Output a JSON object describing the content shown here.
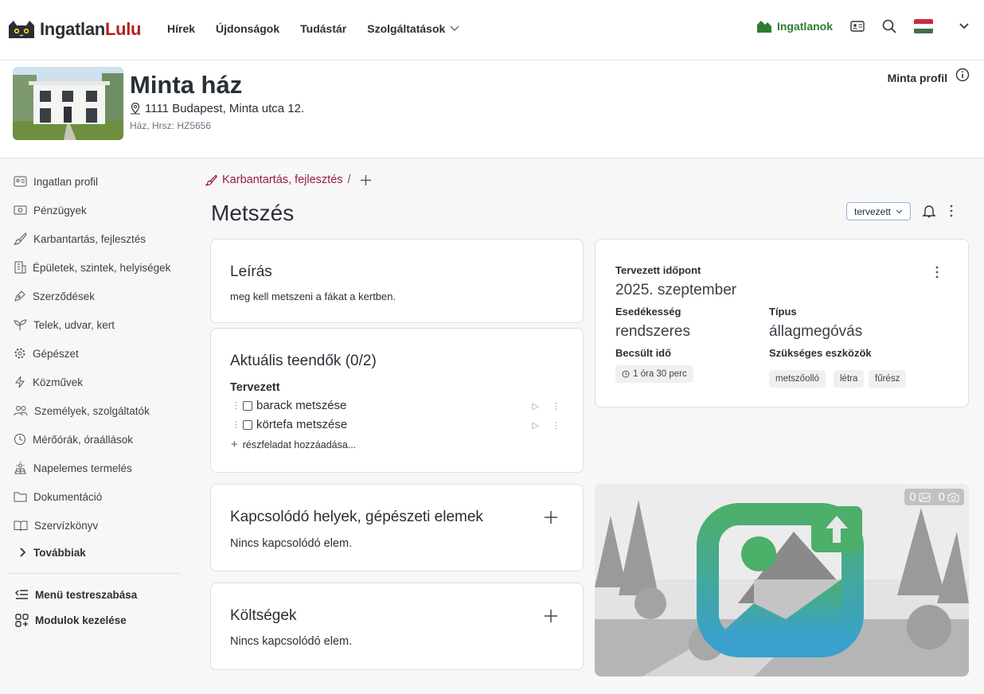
{
  "brand": {
    "part1": "Ingatlan",
    "part2": "Lulu"
  },
  "nav": {
    "items": [
      "Hírek",
      "Újdonságok",
      "Tudástár",
      "Szolgáltatások"
    ]
  },
  "top_right": {
    "properties_label": "Ingatlanok"
  },
  "property": {
    "title": "Minta ház",
    "address": "1111 Budapest, Minta utca 12.",
    "subtitle": "Ház, Hrsz: HZ5656",
    "profile_label": "Minta profil"
  },
  "sidebar": {
    "items": [
      "Ingatlan profil",
      "Pénzügyek",
      "Karbantartás, fejlesztés",
      "Épületek, szintek, helyiségek",
      "Szerződések",
      "Telek, udvar, kert",
      "Gépészet",
      "Közművek",
      "Személyek, szolgáltatók",
      "Mérőórák, óraállások",
      "Napelemes termelés",
      "Dokumentáció",
      "Szervízkönyv"
    ],
    "more": "Továbbiak",
    "customize": "Menü testreszabása",
    "modules": "Modulok kezelése"
  },
  "breadcrumb": {
    "label": "Karbantartás, fejlesztés",
    "separator": "/"
  },
  "page": {
    "title": "Metszés",
    "status": "tervezett"
  },
  "description": {
    "title": "Leírás",
    "text": "meg kell metszeni a fákat a kertben."
  },
  "todos": {
    "title": "Aktuális teendők (0/2)",
    "group": "Tervezett",
    "items": [
      "barack metszése",
      "körtefa metszése"
    ],
    "add_label": "részfeladat hozzáadása..."
  },
  "related": {
    "title": "Kapcsolódó helyek, gépészeti elemek",
    "empty": "Nincs kapcsolódó elem."
  },
  "costs": {
    "title": "Költségek",
    "empty": "Nincs kapcsolódó elem."
  },
  "details": {
    "planned_label": "Tervezett időpont",
    "planned_value": "2025. szeptember",
    "due_label": "Esedékesség",
    "due_value": "rendszeres",
    "type_label": "Típus",
    "type_value": "állagmegóvás",
    "time_label": "Becsült idő",
    "time_value": "1 óra 30 perc",
    "tools_label": "Szükséges eszközök",
    "tools": [
      "metszőolló",
      "létra",
      "fűrész"
    ]
  },
  "media": {
    "image_count": "0",
    "photo_count": "0"
  },
  "colors": {
    "accent_green": "#2e7d32",
    "brand_red": "#b3201f",
    "crumb": "#9b1c3a"
  }
}
